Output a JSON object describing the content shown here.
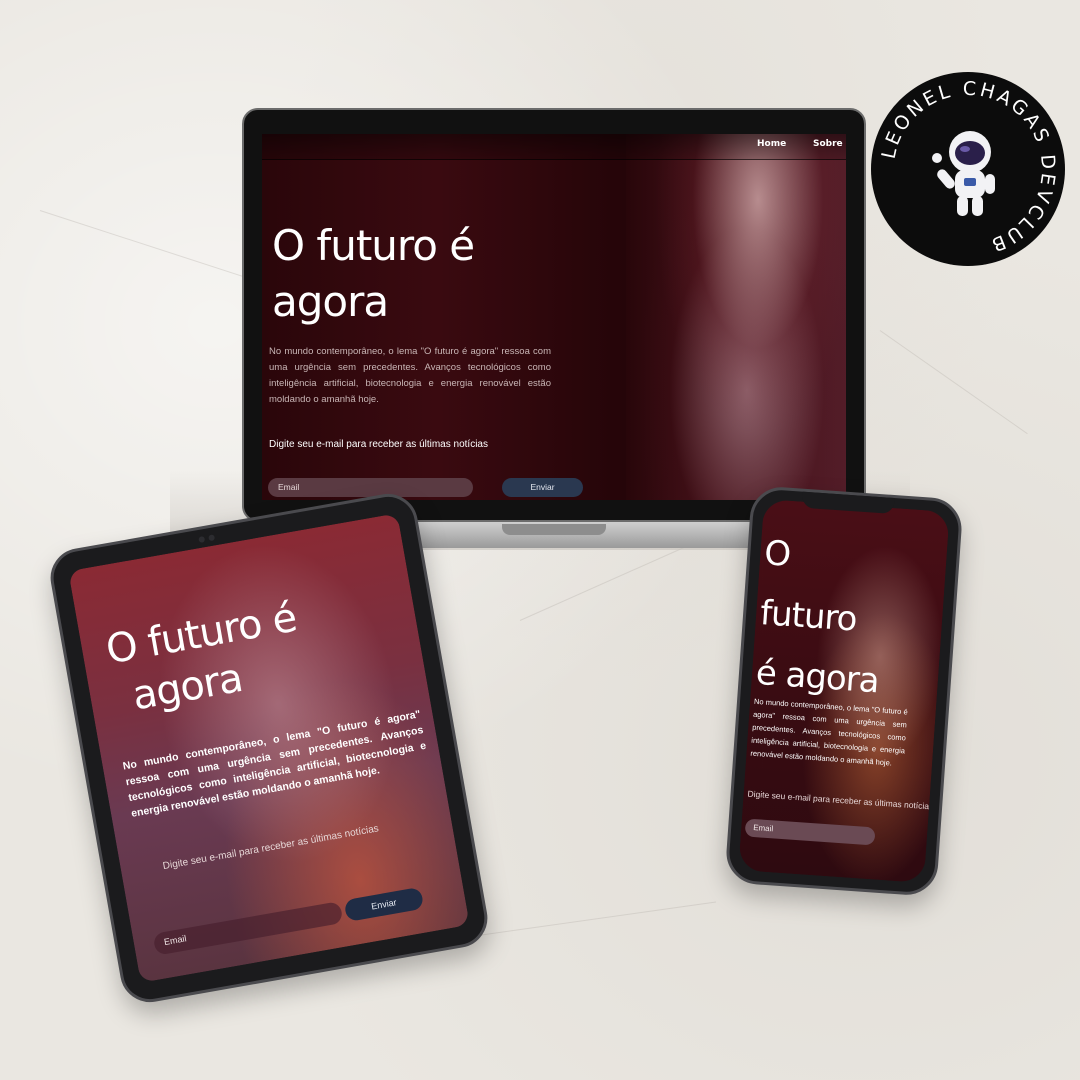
{
  "laptop": {
    "nav": [
      "Home",
      "Sobre N"
    ],
    "title_line1": "O futuro é",
    "title_line2": "agora",
    "paragraph": "No mundo contemporâneo, o lema \"O futuro é agora\" ressoa com uma urgência sem precedentes. Avanços tecnológicos como inteligência artificial, biotecnologia e energia renovável estão moldando o amanhã hoje.",
    "cta": "Digite seu e-mail para receber as últimas notícias",
    "email_placeholder": "Email",
    "send_label": "Enviar"
  },
  "tablet": {
    "title_line1": "O futuro é",
    "title_line2": "agora",
    "paragraph": "No mundo contemporâneo, o lema \"O futuro é agora\" ressoa com uma urgência sem precedentes. Avanços tecnológicos como inteligência artificial, biotecnologia e energia renovável estão moldando o amanhã hoje.",
    "cta": "Digite seu e-mail para receber as últimas notícias",
    "email_placeholder": "Email",
    "send_label": "Enviar"
  },
  "phone": {
    "title_line1": "O",
    "title_line2": "futuro",
    "title_line3": "é agora",
    "paragraph": "No mundo contemporâneo, o lema \"O futuro é agora\" ressoa com uma urgência sem precedentes. Avanços tecnológicos como inteligência artificial, biotecnologia e energia renovável estão moldando o amanhã hoje.",
    "cta": "Digite seu e-mail para receber as últimas notícias",
    "email_placeholder": "Email"
  },
  "badge": {
    "text": "LEONEL CHAGAS DEVCLUB",
    "icon": "astronaut-icon"
  }
}
